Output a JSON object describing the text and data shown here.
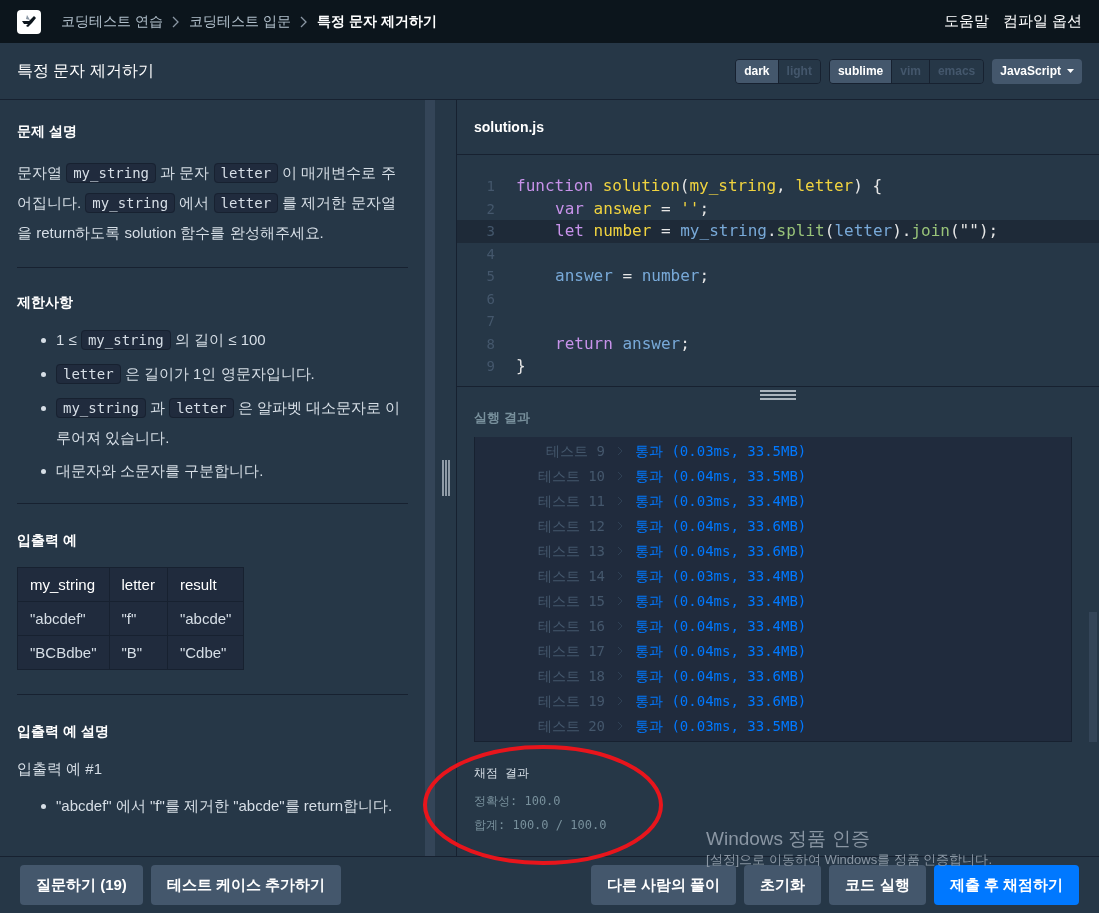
{
  "breadcrumb": [
    {
      "label": "코딩테스트 연습",
      "current": false
    },
    {
      "label": "코딩테스트 입문",
      "current": false
    },
    {
      "label": "특정 문자 제거하기",
      "current": true
    }
  ],
  "top_links": [
    "도움말",
    "컴파일 옵션"
  ],
  "page_title": "특정 문자 제거하기",
  "theme_toggle": [
    {
      "label": "dark",
      "selected": true
    },
    {
      "label": "light",
      "selected": false
    }
  ],
  "keymap_toggle": [
    {
      "label": "sublime",
      "selected": true
    },
    {
      "label": "vim",
      "selected": false
    },
    {
      "label": "emacs",
      "selected": false
    }
  ],
  "language": "JavaScript",
  "description": {
    "heading": "문제 설명",
    "paragraph": [
      {
        "kind": "text",
        "text": "문자열 "
      },
      {
        "kind": "code",
        "text": "my_string"
      },
      {
        "kind": "text",
        "text": " 과 문자 "
      },
      {
        "kind": "code",
        "text": "letter"
      },
      {
        "kind": "text",
        "text": " 이 매개변수로 주어집니다. "
      },
      {
        "kind": "code",
        "text": "my_string"
      },
      {
        "kind": "text",
        "text": " 에서 "
      },
      {
        "kind": "code",
        "text": "letter"
      },
      {
        "kind": "text",
        "text": " 를 제거한 문자열을 return하도록 solution 함수를 완성해주세요."
      }
    ]
  },
  "constraints": {
    "heading": "제한사항",
    "items": [
      [
        {
          "kind": "text",
          "text": "1 ≤ "
        },
        {
          "kind": "code",
          "text": "my_string"
        },
        {
          "kind": "text",
          "text": " 의 길이 ≤ 100"
        }
      ],
      [
        {
          "kind": "code",
          "text": "letter"
        },
        {
          "kind": "text",
          "text": " 은 길이가 1인 영문자입니다."
        }
      ],
      [
        {
          "kind": "code",
          "text": "my_string"
        },
        {
          "kind": "text",
          "text": " 과 "
        },
        {
          "kind": "code",
          "text": "letter"
        },
        {
          "kind": "text",
          "text": " 은 알파벳 대소문자로 이루어져 있습니다."
        }
      ],
      [
        {
          "kind": "text",
          "text": "대문자와 소문자를 구분합니다."
        }
      ]
    ]
  },
  "examples": {
    "heading": "입출력 예",
    "columns": [
      "my_string",
      "letter",
      "result"
    ],
    "rows": [
      [
        "\"abcdef\"",
        "\"f\"",
        "\"abcde\""
      ],
      [
        "\"BCBdbe\"",
        "\"B\"",
        "\"Cdbe\""
      ]
    ]
  },
  "example_notes": {
    "heading": "입출력 예 설명",
    "subheading": "입출력 예 #1",
    "items": [
      "\"abcdef\" 에서 \"f\"를 제거한 \"abcde\"를 return합니다."
    ]
  },
  "editor": {
    "file": "solution.js",
    "lines": [
      {
        "number": "1",
        "active": false,
        "tokens": [
          {
            "kind": "keyword",
            "text": "function "
          },
          {
            "kind": "def",
            "text": "solution"
          },
          {
            "kind": "plain",
            "text": "("
          },
          {
            "kind": "def",
            "text": "my_string"
          },
          {
            "kind": "plain",
            "text": ", "
          },
          {
            "kind": "def",
            "text": "letter"
          },
          {
            "kind": "plain",
            "text": ") {"
          }
        ],
        "children": [
          {
            "number": "2",
            "active": false,
            "tokens": [
              {
                "kind": "keyword",
                "text": "var "
              },
              {
                "kind": "def",
                "text": "answer"
              },
              {
                "kind": "plain",
                "text": " = "
              },
              {
                "kind": "string",
                "text": "''"
              },
              {
                "kind": "plain",
                "text": ";"
              }
            ]
          },
          {
            "number": "3",
            "active": true,
            "tokens": [
              {
                "kind": "keyword",
                "text": "let "
              },
              {
                "kind": "def",
                "text": "number"
              },
              {
                "kind": "plain",
                "text": " = "
              },
              {
                "kind": "var",
                "text": "my_string"
              },
              {
                "kind": "plain",
                "text": "."
              },
              {
                "kind": "method",
                "text": "split"
              },
              {
                "kind": "plain",
                "text": "("
              },
              {
                "kind": "var",
                "text": "letter"
              },
              {
                "kind": "plain",
                "text": ")."
              },
              {
                "kind": "method",
                "text": "join"
              },
              {
                "kind": "plain",
                "text": "(\"\");"
              }
            ]
          },
          {
            "number": "4",
            "active": false
          },
          {
            "number": "5",
            "active": false,
            "tokens": [
              {
                "kind": "var",
                "text": "answer"
              },
              {
                "kind": "plain",
                "text": " = "
              },
              {
                "kind": "var",
                "text": "number"
              },
              {
                "kind": "plain",
                "text": ";"
              }
            ]
          },
          {
            "number": "6",
            "active": false
          },
          {
            "number": "7",
            "active": false
          },
          {
            "number": "8",
            "active": false,
            "tokens": [
              {
                "kind": "keyword",
                "text": "return "
              },
              {
                "kind": "var",
                "text": "answer"
              },
              {
                "kind": "plain",
                "text": ";"
              }
            ]
          }
        ]
      },
      {
        "number": "9",
        "active": false,
        "tokens": [
          {
            "kind": "plain",
            "text": "}"
          }
        ]
      }
    ]
  },
  "results": {
    "heading": "실행 결과",
    "tests": [
      {
        "label": "테스트 9",
        "result": "통과 (0.03ms, 33.5MB)"
      },
      {
        "label": "테스트 10",
        "result": "통과 (0.04ms, 33.5MB)"
      },
      {
        "label": "테스트 11",
        "result": "통과 (0.03ms, 33.4MB)"
      },
      {
        "label": "테스트 12",
        "result": "통과 (0.04ms, 33.6MB)"
      },
      {
        "label": "테스트 13",
        "result": "통과 (0.04ms, 33.6MB)"
      },
      {
        "label": "테스트 14",
        "result": "통과 (0.03ms, 33.4MB)"
      },
      {
        "label": "테스트 15",
        "result": "통과 (0.04ms, 33.4MB)"
      },
      {
        "label": "테스트 16",
        "result": "통과 (0.04ms, 33.4MB)"
      },
      {
        "label": "테스트 17",
        "result": "통과 (0.04ms, 33.4MB)"
      },
      {
        "label": "테스트 18",
        "result": "통과 (0.04ms, 33.6MB)"
      },
      {
        "label": "테스트 19",
        "result": "통과 (0.04ms, 33.6MB)"
      },
      {
        "label": "테스트 20",
        "result": "통과 (0.03ms, 33.5MB)"
      }
    ],
    "grading_heading": "채점 결과",
    "grading_lines": [
      "정확성: 100.0",
      "합계: 100.0 / 100.0"
    ]
  },
  "os_notice": {
    "title": "Windows 정품 인증",
    "text": "[설정]으로 이동하여 Windows를 정품 인증합니다."
  },
  "footer_left": [
    {
      "label": "질문하기 (19)",
      "kind": "secondary"
    },
    {
      "label": "테스트 케이스 추가하기",
      "kind": "secondary"
    }
  ],
  "footer_right": [
    {
      "label": "다른 사람의 풀이",
      "kind": "secondary"
    },
    {
      "label": "초기화",
      "kind": "secondary"
    },
    {
      "label": "코드 실행",
      "kind": "secondary"
    },
    {
      "label": "제출 후 채점하기",
      "kind": "primary"
    }
  ]
}
